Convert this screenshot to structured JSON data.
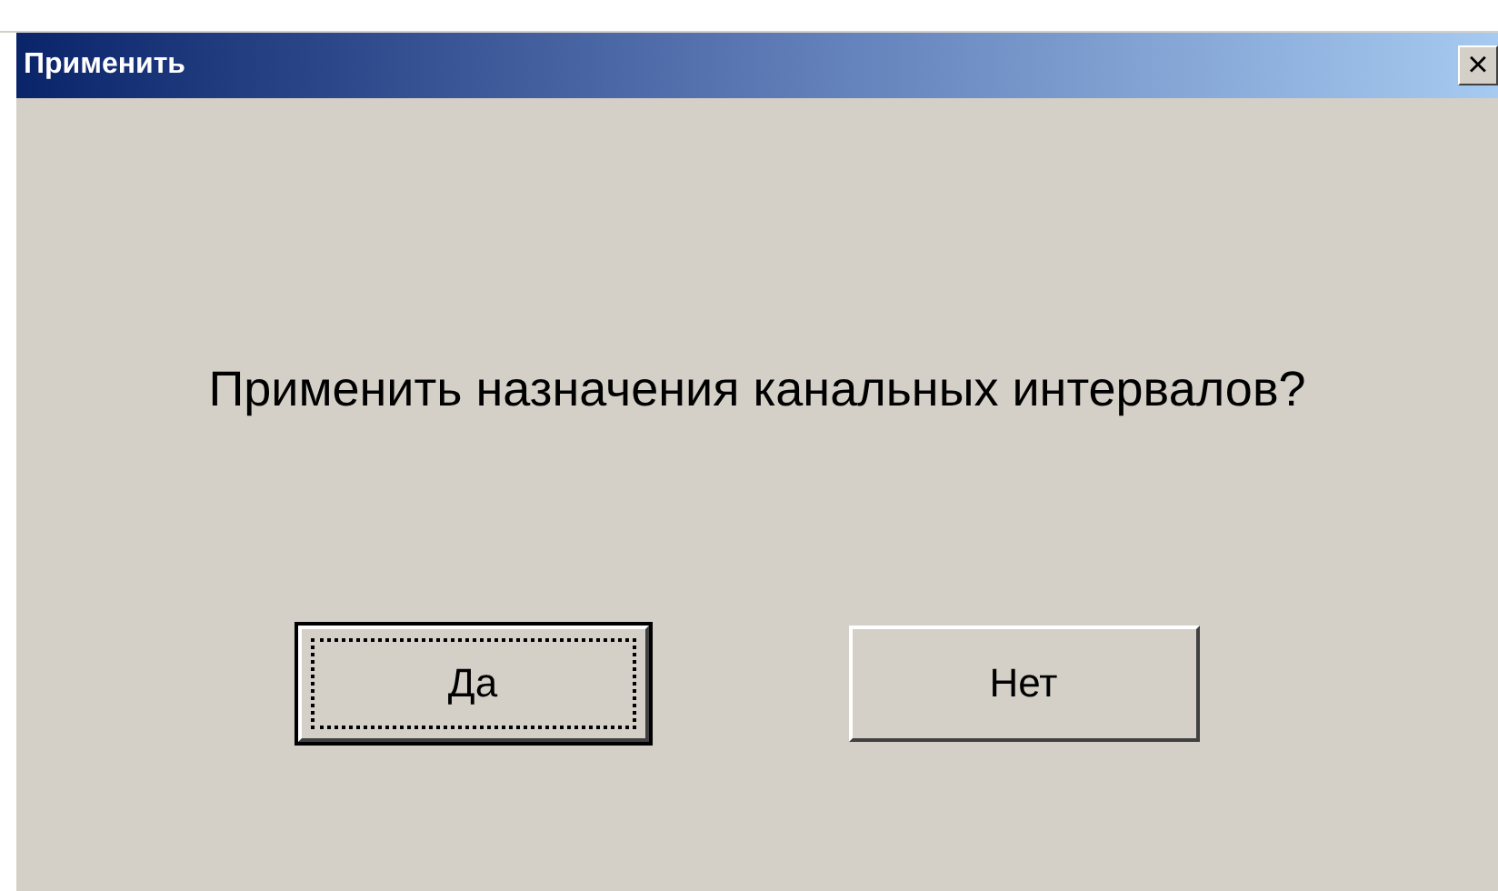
{
  "window": {
    "title": "Применить",
    "close": "×"
  },
  "message": "Применить назначения канальных интервалов?",
  "buttons": [
    {
      "label": "Да",
      "focused": true
    },
    {
      "label": "Нет",
      "focused": false
    }
  ]
}
